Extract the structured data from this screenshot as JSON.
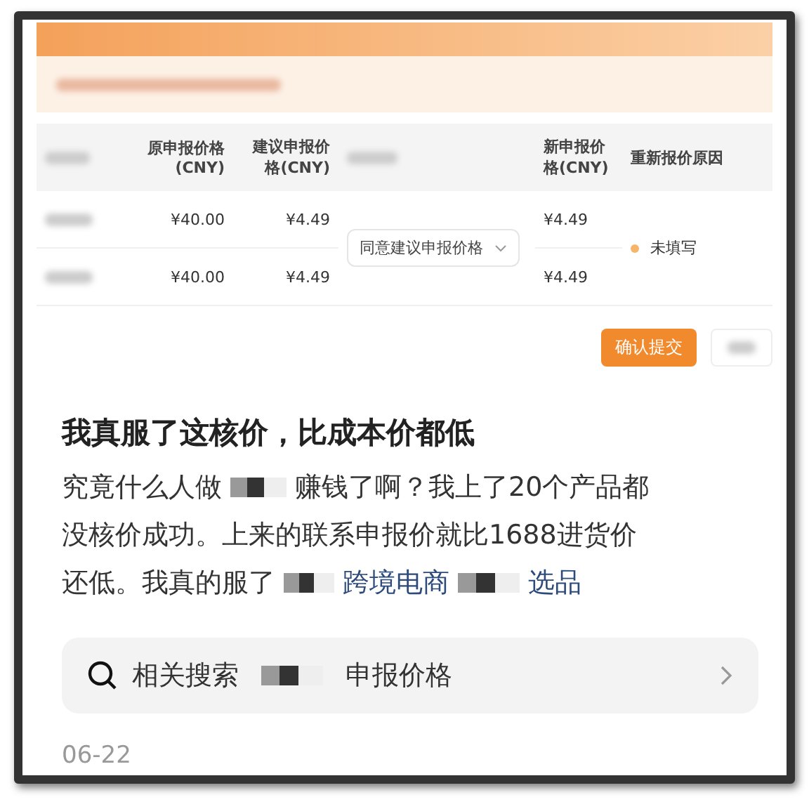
{
  "embedded_screenshot": {
    "table": {
      "columns": [
        {
          "kind": "blurred"
        },
        {
          "kind": "price",
          "label": "原申报价格(CNY)"
        },
        {
          "kind": "price",
          "label": "建议申报价格(CNY)"
        },
        {
          "kind": "blurred"
        },
        {
          "kind": "new",
          "label": "新申报价格(CNY)"
        },
        {
          "kind": "reason",
          "label": "重新报价原因"
        }
      ],
      "rows": [
        {
          "orig": "¥40.00",
          "suggest": "¥4.49",
          "new": "¥4.49"
        },
        {
          "orig": "¥40.00",
          "suggest": "¥4.49",
          "new": "¥4.49"
        }
      ],
      "action_select": "同意建议申报价格",
      "reason": {
        "text": "未填写",
        "color": "#f5b56a"
      }
    },
    "submit_button": "确认提交"
  },
  "post": {
    "title": "我真服了这核价，比成本价都低",
    "body_start": "究竟什么人做",
    "body_lines": [
      "赚钱了啊？我上了20个产品都",
      "没核价成功。上来的联系申报价就比1688进货价",
      "还低。我真的服了"
    ],
    "hashtags": [
      "跨境电商",
      "选品"
    ],
    "related_search": {
      "label": "相关搜索",
      "query_end": "申报价格"
    },
    "date": "06-22"
  }
}
